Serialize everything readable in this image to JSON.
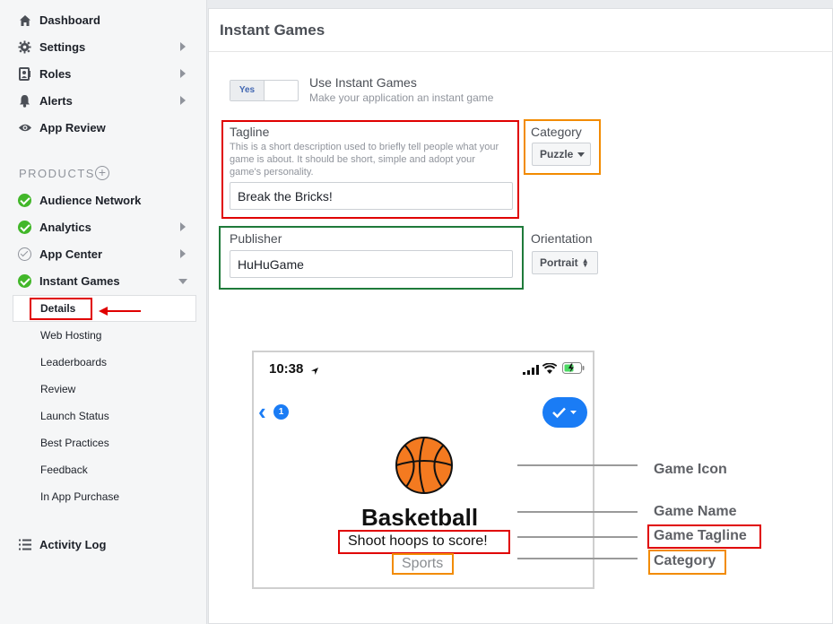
{
  "sidebar": {
    "top_items": [
      {
        "label": "Dashboard",
        "icon": "home-icon"
      },
      {
        "label": "Settings",
        "icon": "gear-icon"
      },
      {
        "label": "Roles",
        "icon": "person-icon"
      },
      {
        "label": "Alerts",
        "icon": "bell-icon"
      },
      {
        "label": "App Review",
        "icon": "eye-icon"
      }
    ],
    "products_heading": "PRODUCTS",
    "products": [
      {
        "label": "Audience Network",
        "status": "enabled"
      },
      {
        "label": "Analytics",
        "status": "enabled"
      },
      {
        "label": "App Center",
        "status": "not-enabled"
      },
      {
        "label": "Instant Games",
        "status": "enabled"
      }
    ],
    "instant_games_sub": [
      "Details",
      "Web Hosting",
      "Leaderboards",
      "Review",
      "Launch Status",
      "Best Practices",
      "Feedback",
      "In App Purchase"
    ],
    "activity_log": "Activity Log"
  },
  "main": {
    "title": "Instant Games",
    "toggle_value": "Yes",
    "use_instant_games": "Use Instant Games",
    "use_instant_games_sub": "Make your application an instant game",
    "tagline_label": "Tagline",
    "tagline_help": "This is a short description used to briefly tell people what your game is about. It should be short, simple and adopt your game's personality.",
    "tagline_value": "Break the Bricks!",
    "category_label": "Category",
    "category_value": "Puzzle",
    "publisher_label": "Publisher",
    "publisher_value": "HuHuGame",
    "orientation_label": "Orientation",
    "orientation_value": "Portrait"
  },
  "preview": {
    "time": "10:38",
    "back_count": "1",
    "game_name": "Basketball",
    "game_tagline": "Shoot hoops to score!",
    "game_category": "Sports",
    "callouts": {
      "icon": "Game Icon",
      "name": "Game Name",
      "tagline": "Game Tagline",
      "category": "Category"
    }
  },
  "colors": {
    "highlight_red": "#e00000",
    "highlight_orange": "#f28b00",
    "highlight_green": "#1f7a3a",
    "ios_blue": "#1a7cf5",
    "status_green": "#42b72a"
  }
}
